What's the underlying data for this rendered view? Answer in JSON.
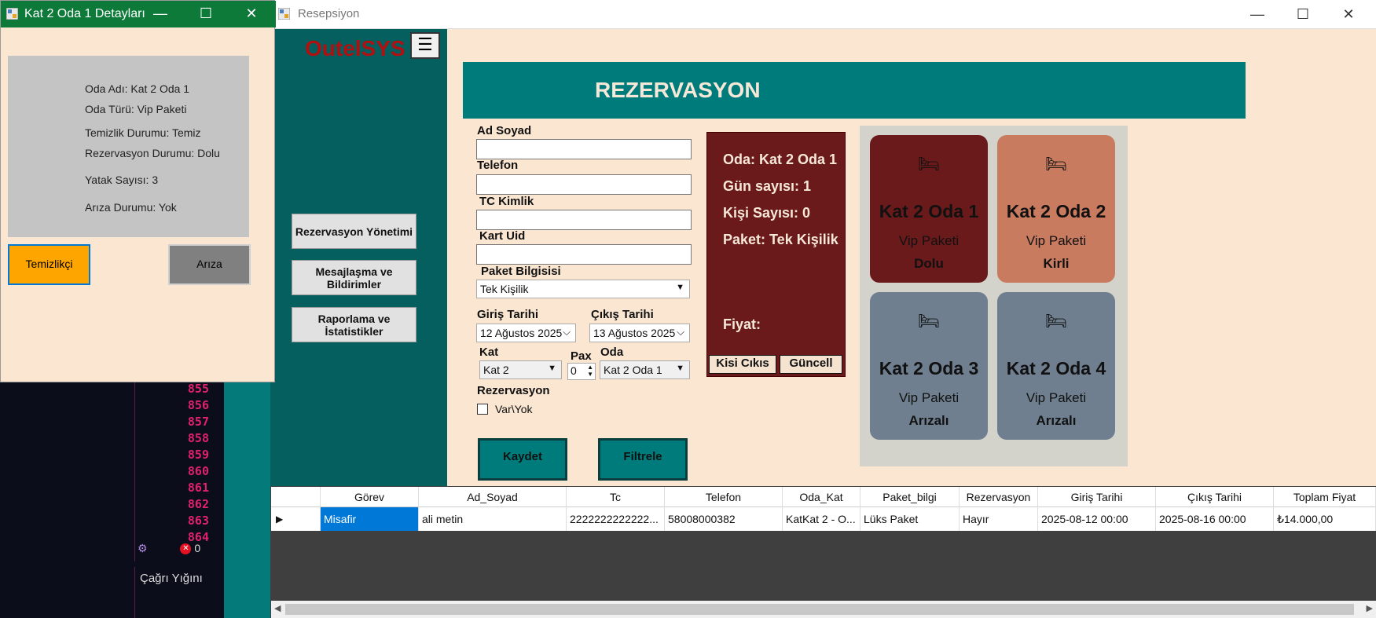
{
  "ide": {
    "line_numbers": [
      "855",
      "856",
      "857",
      "858",
      "859",
      "860",
      "861",
      "862",
      "863",
      "864"
    ],
    "error_count": "0",
    "callstack_label": "Çağrı Yığını"
  },
  "main_window": {
    "title": "Resepsiyon",
    "logo": "OutelSYS",
    "sidebar": [
      {
        "label": "Rezervasyon Yönetimi"
      },
      {
        "label": "Mesajlaşma ve Bildirimler"
      },
      {
        "label": "Raporlama ve İstatistikler"
      }
    ],
    "banner": "REZERVASYON"
  },
  "form": {
    "ad_soyad_label": "Ad Soyad",
    "telefon_label": "Telefon",
    "tc_label": "TC Kimlik",
    "kart_label": "Kart Uid",
    "paket_label": "Paket Bilgisisi",
    "paket_value": "Tek Kişilik",
    "giris_label": "Giriş Tarihi",
    "giris_value": "12 Ağustos 2025",
    "cikis_label": "Çıkış Tarihi",
    "cikis_value": "13 Ağustos 2025",
    "kat_label": "Kat",
    "kat_value": "Kat 2",
    "pax_label": "Pax",
    "pax_value": "0",
    "oda_label": "Oda",
    "oda_value": "Kat 2 Oda 1",
    "rezervasyon_label": "Rezervasyon",
    "varyok_label": "Var\\Yok",
    "kaydet": "Kaydet",
    "filtrele": "Filtrele"
  },
  "summary": {
    "oda": "Oda: Kat 2 Oda 1",
    "gun": "Gün sayısı: 1",
    "kisi": "Kişi Sayısı: 0",
    "paket": "Paket: Tek Kişilik",
    "fiyat": "Fiyat:",
    "kisi_cikis": "Kisi Cıkıs",
    "guncell": "Güncell"
  },
  "rooms": [
    {
      "name": "Kat 2 Oda 1",
      "package": "Vip Paketi",
      "status": "Dolu",
      "color": "#6a1a1a"
    },
    {
      "name": "Kat 2 Oda 2",
      "package": "Vip Paketi",
      "status": "Kirli",
      "color": "#c97b5f"
    },
    {
      "name": "Kat 2 Oda 3",
      "package": "Vip Paketi",
      "status": "Arızalı",
      "color": "#6f7f8f"
    },
    {
      "name": "Kat 2 Oda 4",
      "package": "Vip Paketi",
      "status": "Arızalı",
      "color": "#6f7f8f"
    }
  ],
  "grid": {
    "columns": [
      "Görev",
      "Ad_Soyad",
      "Tc",
      "Telefon",
      "Oda_Kat",
      "Paket_bilgi",
      "Rezervasyon",
      "Giriş Tarihi",
      "Çıkış Tarihi",
      "Toplam Fiyat"
    ],
    "row": [
      "Misafir",
      "ali metin",
      "2222222222222...",
      "58008000382",
      "KatKat 2 - O...",
      "Lüks Paket",
      "Hayır",
      "2025-08-12 00:00",
      "2025-08-16 00:00",
      "₺14.000,00"
    ]
  },
  "detail_window": {
    "title": "Kat 2 Oda 1 Detayları",
    "oda_adi": "Oda Adı: Kat 2 Oda 1",
    "oda_turu": "Oda Türü: Vip Paketi",
    "temizlik": "Temizlik Durumu: Temiz",
    "rezervasyon": "Rezervasyon Durumu: Dolu",
    "yatak": "Yatak Sayısı: 3",
    "ariza": "Arıza Durumu: Yok",
    "temizlikci_btn": "Temizlikçi",
    "ariza_btn": "Arıza"
  },
  "colors": {
    "teal": "#007b7b",
    "sidebar": "#055f5f",
    "background": "#fbe6d2",
    "title_green": "#0e7a3a",
    "orange": "#ffa500"
  }
}
